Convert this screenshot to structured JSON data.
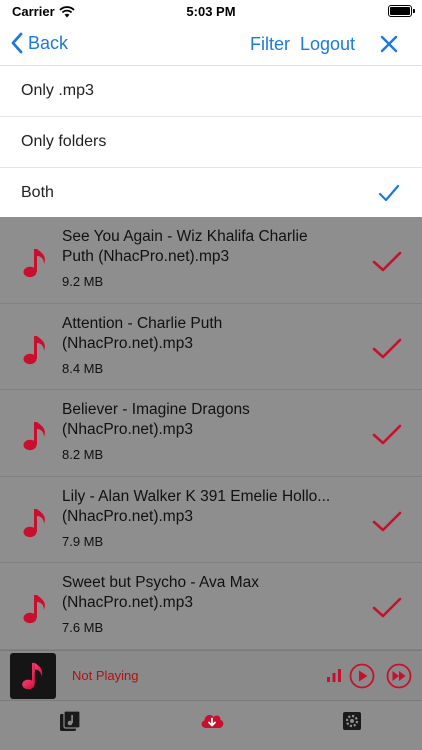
{
  "status_bar": {
    "carrier": "Carrier",
    "time": "5:03 PM"
  },
  "nav": {
    "back_label": "Back",
    "filter_label": "Filter",
    "logout_label": "Logout"
  },
  "filter_menu": {
    "options": [
      {
        "label": "Only .mp3",
        "selected": false
      },
      {
        "label": "Only folders",
        "selected": false
      },
      {
        "label": "Both",
        "selected": true
      }
    ]
  },
  "songs": [
    {
      "title": "See You Again - Wiz Khalifa Charlie\nPuth (NhacPro.net).mp3",
      "size": "9.2 MB",
      "downloaded": true
    },
    {
      "title": "Attention - Charlie Puth\n(NhacPro.net).mp3",
      "size": "8.4 MB",
      "downloaded": true
    },
    {
      "title": "Believer - Imagine Dragons\n(NhacPro.net).mp3",
      "size": "8.2 MB",
      "downloaded": true
    },
    {
      "title": "Lily - Alan Walker K 391 Emelie Hollo...\n(NhacPro.net).mp3",
      "size": "7.9 MB",
      "downloaded": true
    },
    {
      "title": "Sweet but Psycho - Ava Max\n(NhacPro.net).mp3",
      "size": "7.6 MB",
      "downloaded": true
    }
  ],
  "player": {
    "status": "Not Playing"
  },
  "colors": {
    "accent": "#1a7ae0",
    "brand_red": "#c8102e",
    "overlay": "#8e8e8e"
  },
  "icons": {
    "back": "chevron-left-icon",
    "close": "close-icon",
    "selected": "checkmark-icon",
    "song": "music-note-icon",
    "downloaded": "checkmark-icon",
    "tabs": [
      "library-icon",
      "cloud-download-icon",
      "gear-icon"
    ]
  }
}
